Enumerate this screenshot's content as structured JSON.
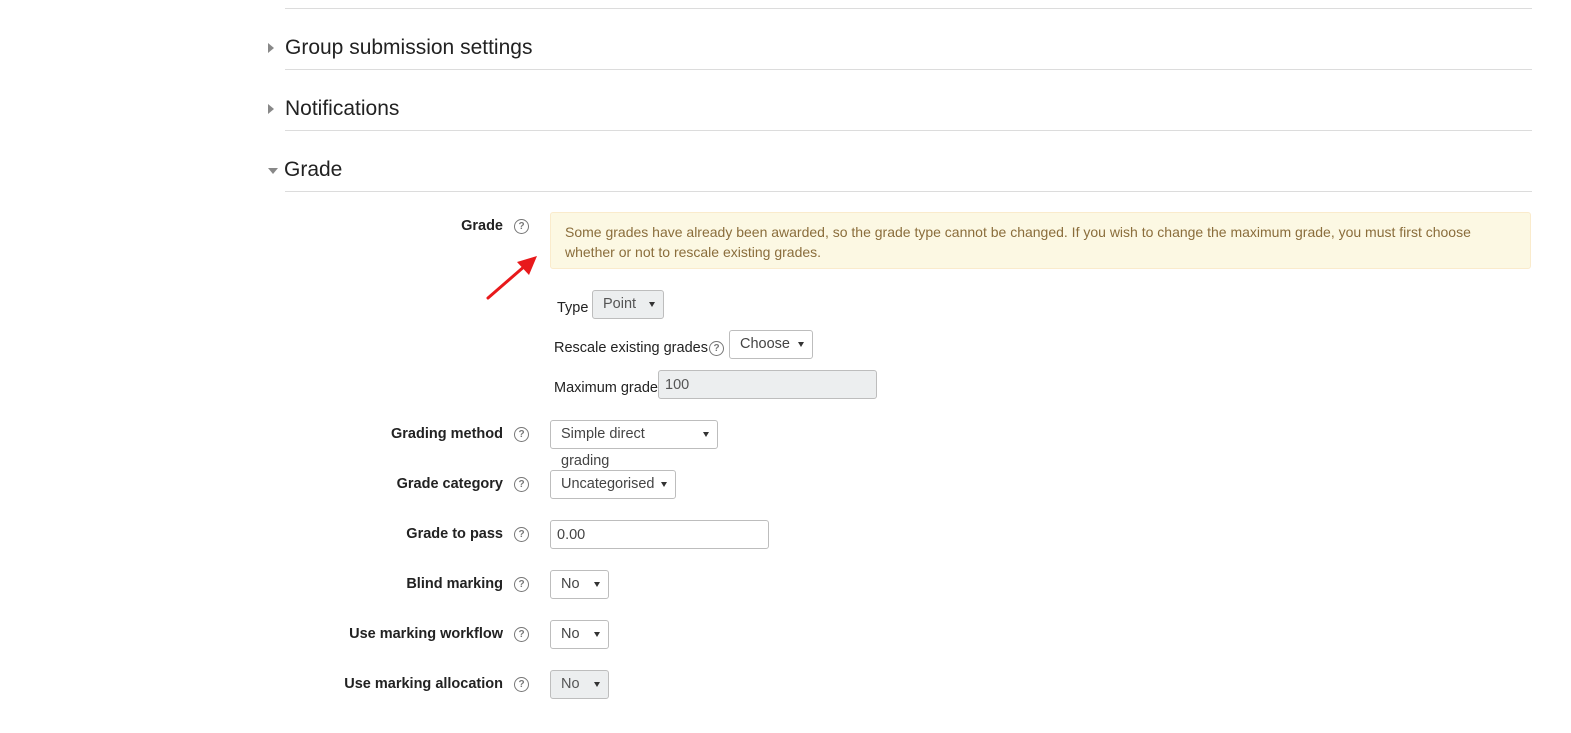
{
  "sections": {
    "group_submission": "Group submission settings",
    "notifications": "Notifications",
    "grade": "Grade"
  },
  "grade": {
    "label": "Grade",
    "warning": "Some grades have already been awarded, so the grade type cannot be changed. If you wish to change the maximum grade, you must first choose whether or not to rescale existing grades.",
    "type_label": "Type",
    "type_value": "Point",
    "rescale_label": "Rescale existing grades",
    "rescale_value": "Choose",
    "max_label": "Maximum grade",
    "max_value": "100"
  },
  "fields": {
    "grading_method": {
      "label": "Grading method",
      "value": "Simple direct grading"
    },
    "grade_category": {
      "label": "Grade category",
      "value": "Uncategorised"
    },
    "grade_to_pass": {
      "label": "Grade to pass",
      "value": "0.00"
    },
    "blind_marking": {
      "label": "Blind marking",
      "value": "No"
    },
    "marking_workflow": {
      "label": "Use marking workflow",
      "value": "No"
    },
    "marking_allocation": {
      "label": "Use marking allocation",
      "value": "No"
    }
  },
  "icons": {
    "help": "?"
  },
  "colors": {
    "alert_bg": "#fcf8e3",
    "alert_text": "#8a6d3b",
    "annotation_arrow": "#e8191b"
  }
}
